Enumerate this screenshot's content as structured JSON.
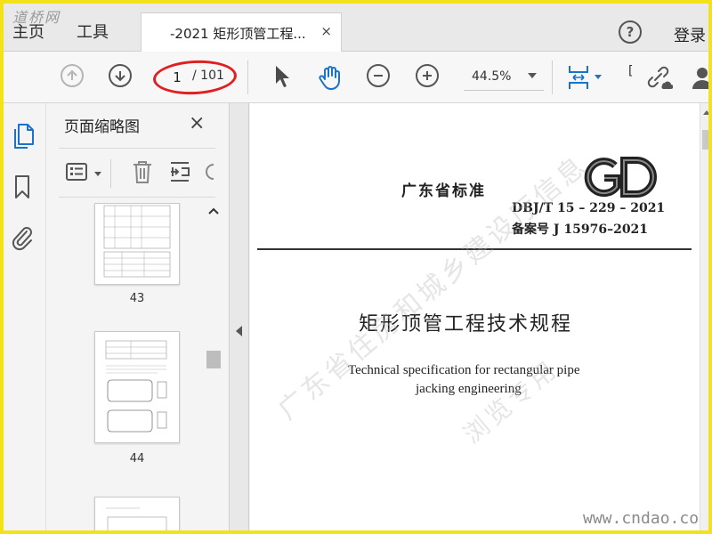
{
  "app": {
    "tabs": {
      "home": "主页",
      "tools": "工具",
      "document": "-2021 矩形顶管工程...",
      "close": "×"
    },
    "help": "?",
    "login": "登录",
    "site_watermark": "道桥网"
  },
  "toolbar": {
    "page_current": "1",
    "page_total": "/ 101",
    "zoom": "44.5%",
    "icons": [
      "prev-page-icon",
      "next-page-icon",
      "select-cursor-icon",
      "hand-tool-icon",
      "zoom-out-icon",
      "zoom-in-icon",
      "fit-page-icon",
      "link-icon",
      "user-icon"
    ]
  },
  "sidebar": {
    "icons": [
      "page-thumbnails-icon",
      "bookmark-icon",
      "attachment-icon"
    ]
  },
  "thumbnails_panel": {
    "title": "页面缩略图",
    "close": "×",
    "tool_icons": [
      "options-menu-icon",
      "delete-icon",
      "insert-page-icon",
      "rotate-icon"
    ],
    "pages": [
      {
        "number": "43"
      },
      {
        "number": "44"
      },
      {
        "number": ""
      }
    ]
  },
  "document": {
    "standard_label": "广东省标准",
    "logo": "GD",
    "code": "DBJ/T 15 – 229 – 2021",
    "record": "备案号  J 15976–2021",
    "title_cn": "矩形顶管工程技术规程",
    "title_en_line1": "Technical specification for  rectangular pipe",
    "title_en_line2": "jacking engineering",
    "watermark_diag1": "广东省住房和城乡建设厅信息",
    "watermark_diag2": "浏览专用",
    "watermark_url": "www.cndao.com"
  },
  "colors": {
    "frame": "#f3e21a",
    "annotation_ellipse": "#e02020",
    "accent_blue": "#1a73c9"
  }
}
